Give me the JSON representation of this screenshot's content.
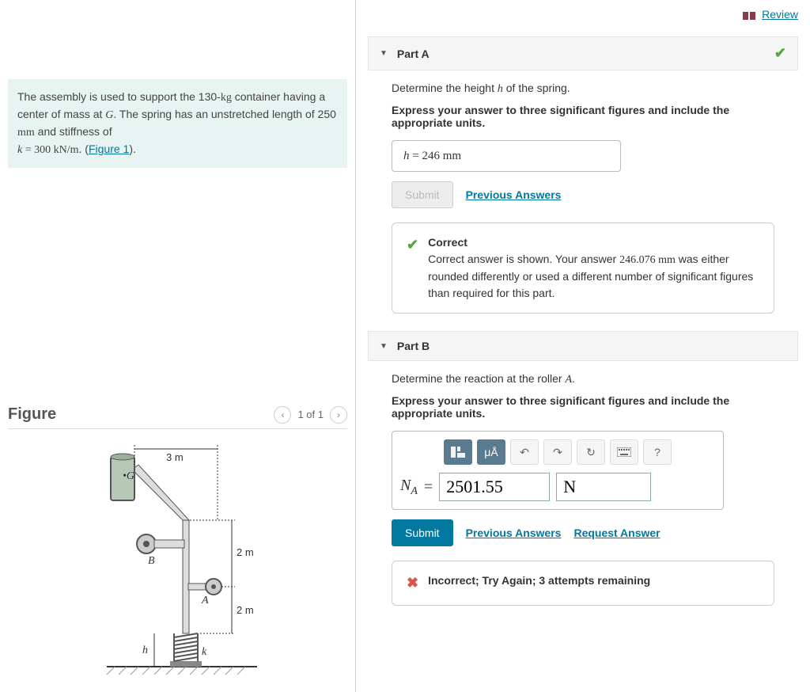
{
  "review": {
    "label": "Review"
  },
  "problem": {
    "text_before_figure": "The assembly is used to support the 130-",
    "text_kg": "kg",
    "text_mid": " container having a center of mass at ",
    "G": "G",
    "text_after_G": ". The spring has an unstretched length of 250 ",
    "mm": "mm",
    "text_stiff": " and stiffness of ",
    "k_eq": "k = 300 kN/m",
    "text_period": ". (",
    "figure_link": "Figure 1",
    "close": ")."
  },
  "figure": {
    "title": "Figure",
    "counter": "1 of 1",
    "labels": {
      "dim3m": "3 m",
      "dim2m_a": "2 m",
      "dim2m_b": "2 m",
      "G": "G",
      "B": "B",
      "A": "A",
      "h": "h",
      "k": "k"
    }
  },
  "partA": {
    "title": "Part A",
    "prompt_before": "Determine the height ",
    "prompt_h": "h",
    "prompt_after": " of the spring.",
    "instruct": "Express your answer to three significant figures and include the appropriate units.",
    "answer": "h =  246 mm",
    "submit": "Submit",
    "prev": "Previous Answers",
    "fb_title": "Correct",
    "fb_text_a": "Correct answer is shown. Your answer ",
    "fb_val": "246.076 mm",
    "fb_text_b": " was either rounded differently or used a different number of significant figures than required for this part."
  },
  "partB": {
    "title": "Part B",
    "prompt_before": "Determine the reaction at the roller ",
    "prompt_A": "A",
    "prompt_after": ".",
    "instruct": "Express your answer to three significant figures and include the appropriate units.",
    "label_N": "N",
    "label_sub": "A",
    "eq": " = ",
    "value": "2501.55",
    "unit": "N",
    "submit": "Submit",
    "prev": "Previous Answers",
    "req": "Request Answer",
    "fb": "Incorrect; Try Again; 3 attempts remaining",
    "toolbar": {
      "units": "μÅ",
      "help": "?"
    }
  }
}
